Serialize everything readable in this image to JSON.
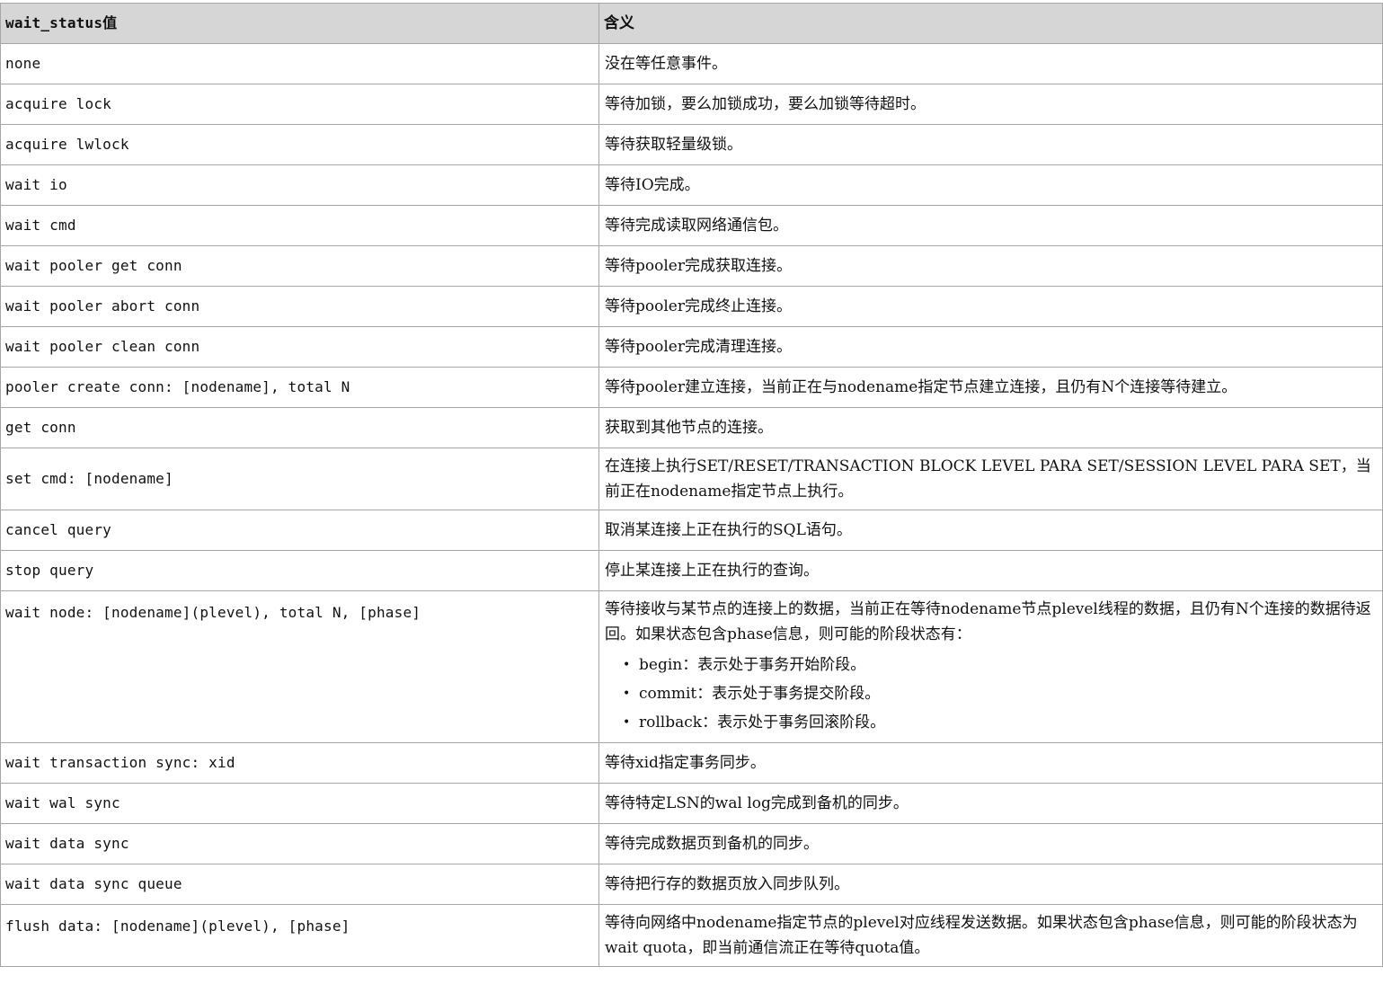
{
  "table": {
    "headers": [
      "wait_status值",
      "含义"
    ],
    "rows": [
      {
        "status": "none",
        "meaning": "没在等任意事件。"
      },
      {
        "status": "acquire lock",
        "meaning": "等待加锁，要么加锁成功，要么加锁等待超时。"
      },
      {
        "status": "acquire lwlock",
        "meaning": "等待获取轻量级锁。"
      },
      {
        "status": "wait io",
        "meaning": "等待IO完成。"
      },
      {
        "status": "wait cmd",
        "meaning": "等待完成读取网络通信包。"
      },
      {
        "status": "wait pooler get conn",
        "meaning": "等待pooler完成获取连接。"
      },
      {
        "status": "wait pooler abort conn",
        "meaning": "等待pooler完成终止连接。"
      },
      {
        "status": "wait pooler clean conn",
        "meaning": "等待pooler完成清理连接。"
      },
      {
        "status": "pooler create conn: [nodename], total N",
        "meaning": "等待pooler建立连接，当前正在与nodename指定节点建立连接，且仍有N个连接等待建立。"
      },
      {
        "status": "get conn",
        "meaning": "获取到其他节点的连接。"
      },
      {
        "status": "set cmd: [nodename]",
        "meaning": "在连接上执行SET/RESET/TRANSACTION BLOCK LEVEL PARA SET/SESSION LEVEL PARA SET，当前正在nodename指定节点上执行。"
      },
      {
        "status": "cancel query",
        "meaning": "取消某连接上正在执行的SQL语句。"
      },
      {
        "status": "stop query",
        "meaning": "停止某连接上正在执行的查询。"
      },
      {
        "status": "wait node: [nodename](plevel), total N, [phase]",
        "meaning": "等待接收与某节点的连接上的数据，当前正在等待nodename节点plevel线程的数据，且仍有N个连接的数据待返回。如果状态包含phase信息，则可能的阶段状态有：",
        "phases": [
          "begin：表示处于事务开始阶段。",
          "commit：表示处于事务提交阶段。",
          "rollback：表示处于事务回滚阶段。"
        ]
      },
      {
        "status": "wait transaction sync: xid",
        "meaning": "等待xid指定事务同步。"
      },
      {
        "status": "wait wal sync",
        "meaning": "等待特定LSN的wal log完成到备机的同步。"
      },
      {
        "status": "wait data sync",
        "meaning": "等待完成数据页到备机的同步。"
      },
      {
        "status": "wait data sync queue",
        "meaning": "等待把行存的数据页放入同步队列。"
      },
      {
        "status": "flush data: [nodename](plevel), [phase]",
        "meaning": "等待向网络中nodename指定节点的plevel对应线程发送数据。如果状态包含phase信息，则可能的阶段状态为wait quota，即当前通信流正在等待quota值。"
      }
    ]
  },
  "colors": {
    "header_bg": "#d6d6d6",
    "border": "#a6a6a6",
    "text": "#111111"
  }
}
